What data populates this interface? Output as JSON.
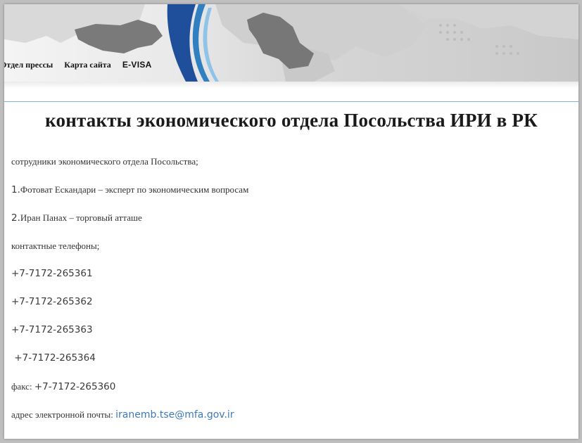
{
  "nav": {
    "items": [
      {
        "label": "Отдел прессы"
      },
      {
        "label": "Карта сайта"
      },
      {
        "label": "E-VISA"
      }
    ]
  },
  "page": {
    "title": "контакты экономического отдела Посольства ИРИ в РК"
  },
  "content": {
    "staff_heading": "сотрудники экономического отдела Посольства;",
    "staff": [
      {
        "number": " 1.",
        "text": "Фотоват Ескандари – эксперт по экономическим вопросам"
      },
      {
        "number": "2.",
        "text": "Иран Панах – торговый атташе"
      }
    ],
    "phones_heading": "контактные телефоны;",
    "phones": [
      "+7-7172-265361",
      "+7-7172-265362",
      "+7-7172-265363",
      " +7-7172-265364"
    ],
    "fax_label": "факс: ",
    "fax_value": "+7-7172-265360",
    "email_label": "адрес электронной почты: ",
    "email_value": "iranemb.tse@mfa.gov.ir"
  },
  "colors": {
    "link": "#3d7ab8",
    "divider": "#7fb8cf",
    "accent_blue": "#1f4e9a"
  }
}
